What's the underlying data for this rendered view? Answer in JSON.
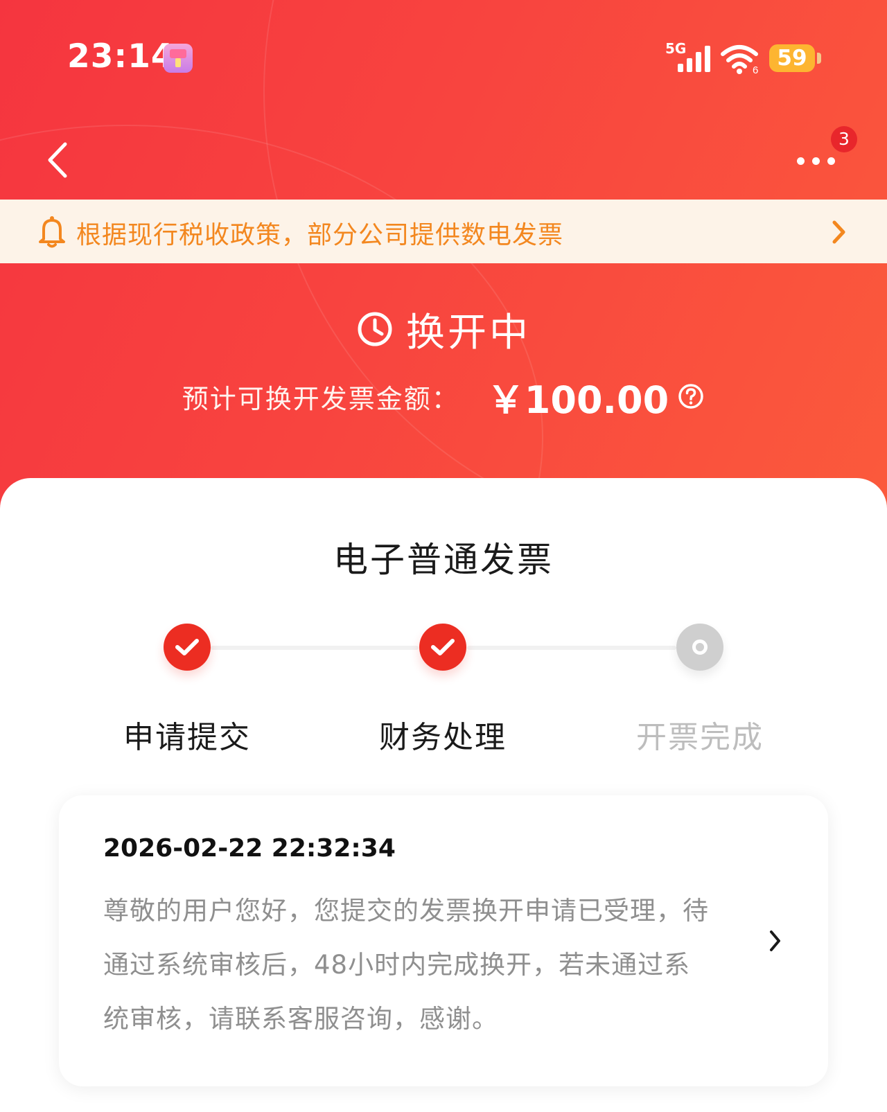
{
  "status_bar": {
    "time": "23:14",
    "network": "5G",
    "wifi_label": "6",
    "battery": "59"
  },
  "nav": {
    "badge_count": "3"
  },
  "notice": {
    "text": "根据现行税收政策，部分公司提供数电发票"
  },
  "status": {
    "title": "换开中",
    "amount_label": "预计可换开发票金额：",
    "amount_value": "￥100.00"
  },
  "invoice": {
    "type": "电子普通发票",
    "steps": [
      {
        "label": "申请提交",
        "state": "done"
      },
      {
        "label": "财务处理",
        "state": "done"
      },
      {
        "label": "开票完成",
        "state": "pending"
      }
    ]
  },
  "message": {
    "timestamp": "2026-02-22 22:32:34",
    "body": "尊敬的用户您好，您提交的发票换开申请已受理，待通过系统审核后，48小时内完成换开，若未通过系统审核，请联系客服咨询，感谢。"
  },
  "colors": {
    "brand_red": "#f5353f",
    "notice_orange": "#f3871f",
    "step_done": "#ec2d22",
    "step_pending": "#cfcfcf"
  }
}
